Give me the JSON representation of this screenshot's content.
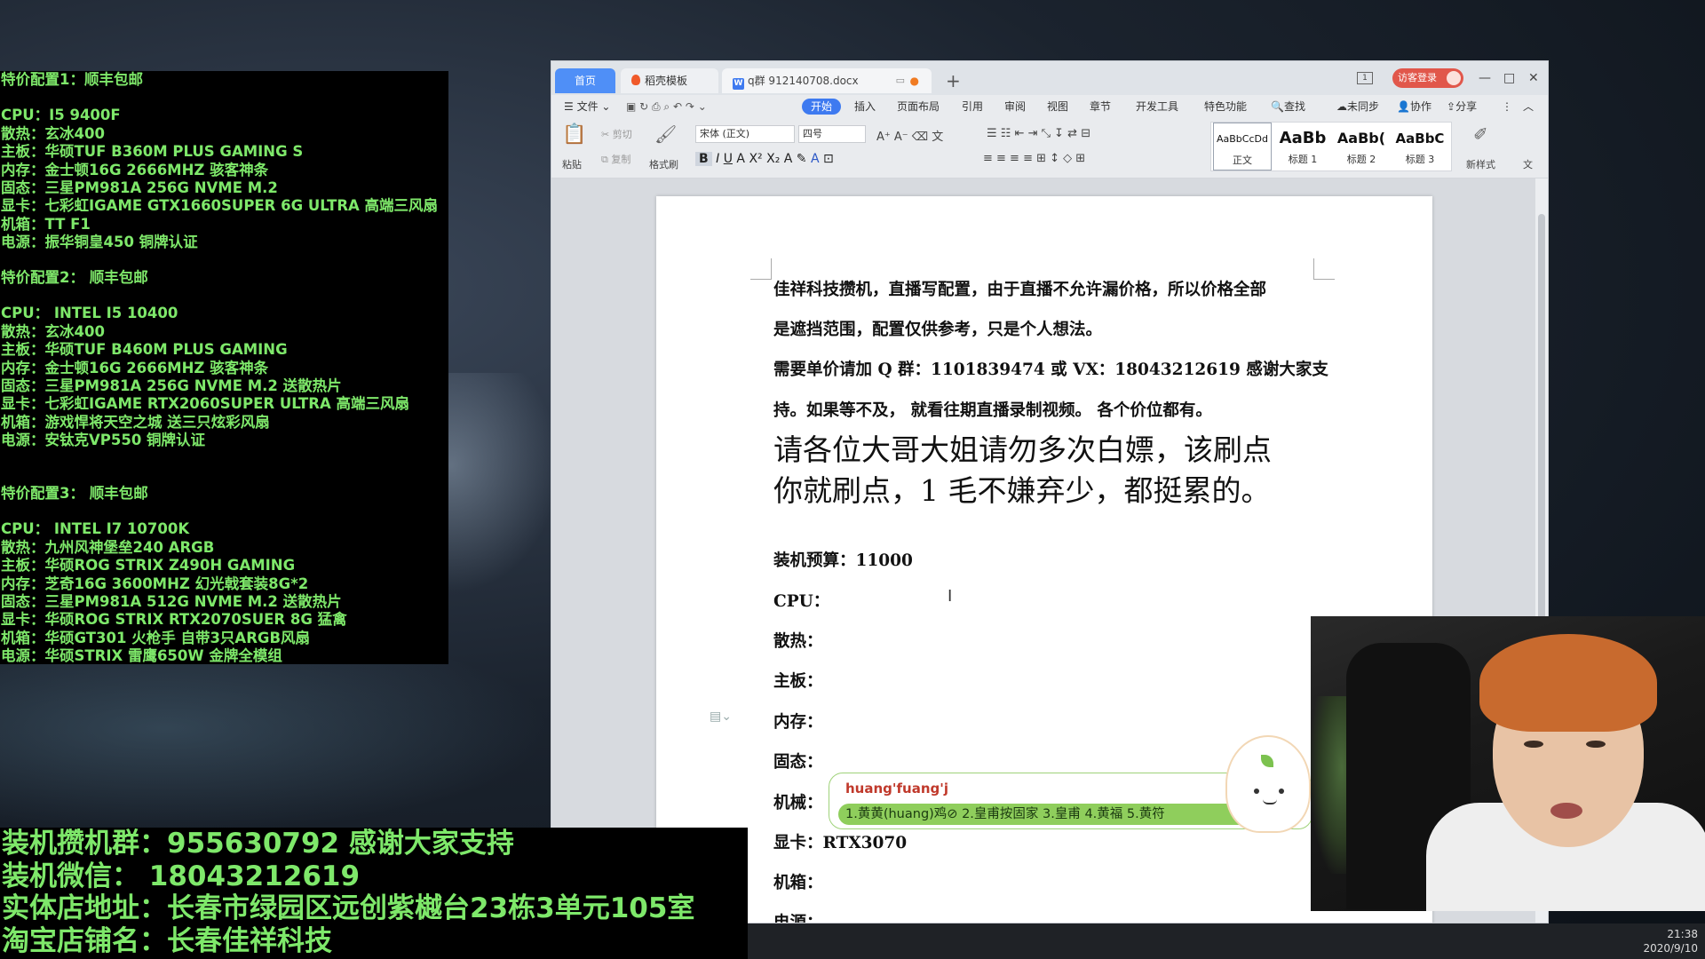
{
  "config_panel": {
    "groups": [
      {
        "heading": "特价配置1：顺丰包邮",
        "lines": [
          "CPU：I5 9400F",
          "散热：玄冰400",
          "主板：华硕TUF B360M PLUS GAMING S",
          "内存：金士顿16G 2666MHZ 骇客神条",
          "固态：三星PM981A 256G NVME M.2",
          "显卡：七彩虹IGAME GTX1660SUPER 6G ULTRA 高端三风扇",
          "机箱：TT F1",
          "电源：振华铜皇450 铜牌认证"
        ]
      },
      {
        "heading": "特价配置2：  顺丰包邮",
        "lines": [
          "CPU：  INTEL I5 10400",
          "散热：玄冰400",
          "主板：华硕TUF B460M PLUS GAMING",
          "内存：金士顿16G 2666MHZ 骇客神条",
          "固态：三星PM981A 256G NVME M.2 送散热片",
          "显卡：七彩虹IGAME RTX2060SUPER ULTRA 高端三风扇",
          "机箱：游戏悍将天空之城 送三只炫彩风扇",
          "电源：安钛克VP550 铜牌认证"
        ]
      },
      {
        "heading": "特价配置3：  顺丰包邮",
        "lines": [
          "CPU：  INTEL I7 10700K",
          "散热：九州风神堡垒240 ARGB",
          "主板：华硕ROG STRIX Z490H GAMING",
          "内存：芝奇16G 3600MHZ 幻光戟套装8G*2",
          "固态：三星PM981A 512G NVME M.2 送散热片",
          "显卡：华硕ROG STRIX RTX2070SUER 8G 猛禽",
          "机箱：华硕GT301 火枪手 自带3只ARGB风扇",
          "电源：华硕STRIX 雷鹰650W 金牌全模组"
        ]
      }
    ]
  },
  "banner": {
    "lines": [
      "装机攒机群：955630792 感谢大家支持",
      "装机微信：  18043212619",
      "实体店地址：长春市绿园区远创紫樾台23栋3单元105室",
      "淘宝店铺名：长春佳祥科技"
    ]
  },
  "wps": {
    "tabs": {
      "home": "首页",
      "template": "稻壳模板",
      "doc": "q群 912140708.docx",
      "add": "+"
    },
    "login": "访客登录",
    "window_controls": {
      "minimize": "—",
      "maximize": "□",
      "close": "✕",
      "layout": "1"
    },
    "menu": {
      "file": "☰ 文件 ⌄",
      "items": [
        "开始",
        "插入",
        "页面布局",
        "引用",
        "审阅",
        "视图",
        "章节",
        "开发工具",
        "特色功能"
      ],
      "search": "🔍查找",
      "sync": "未同步",
      "collab": "协作",
      "share": "分享"
    },
    "ribbon": {
      "paste": "粘贴",
      "cut": "剪切",
      "copy": "复制",
      "format_painter": "格式刷",
      "font_name": "宋体 (正文)",
      "font_size": "四号",
      "new_style": "新样式",
      "text_label": "文",
      "styles": [
        {
          "sample": "AaBbCcDd",
          "name": "正文"
        },
        {
          "sample": "AaBb",
          "name": "标题 1"
        },
        {
          "sample": "AaBb(",
          "name": "标题 2"
        },
        {
          "sample": "AaBbC",
          "name": "标题 3"
        }
      ]
    },
    "document": {
      "para1_line1": "佳祥科技攒机，直播写配置，由于直播不允许漏价格，所以价格全部",
      "para1_line2": "是遮挡范围，配置仅供参考，只是个人想法。",
      "para2_line1": "需要单价请加 Q 群：1101839474  或 VX：18043212619  感谢大家支",
      "para2_line2": "持。如果等不及，  就看往期直播录制视频。  各个价位都有。",
      "big_line1": "请各位大哥大姐请勿多次白嫖，该刷点",
      "big_line2": "你就刷点，1 毛不嫌弃少，都挺累的。",
      "budget": "装机预算：11000",
      "fields": [
        "CPU：",
        "散热：",
        "主板：",
        "内存：",
        "固态：",
        "机械："
      ],
      "gpu": "显卡：RTX3070",
      "case": "机箱：",
      "power": "电源："
    }
  },
  "ime": {
    "input": "huang'fuang'j",
    "candidates": "1.黄黄(huang)鸡⊘   2.皇甫按固家   3.皇甫   4.黄福   5.黄符"
  },
  "taskbar": {
    "time": "21:38",
    "date": "2020/9/10"
  }
}
